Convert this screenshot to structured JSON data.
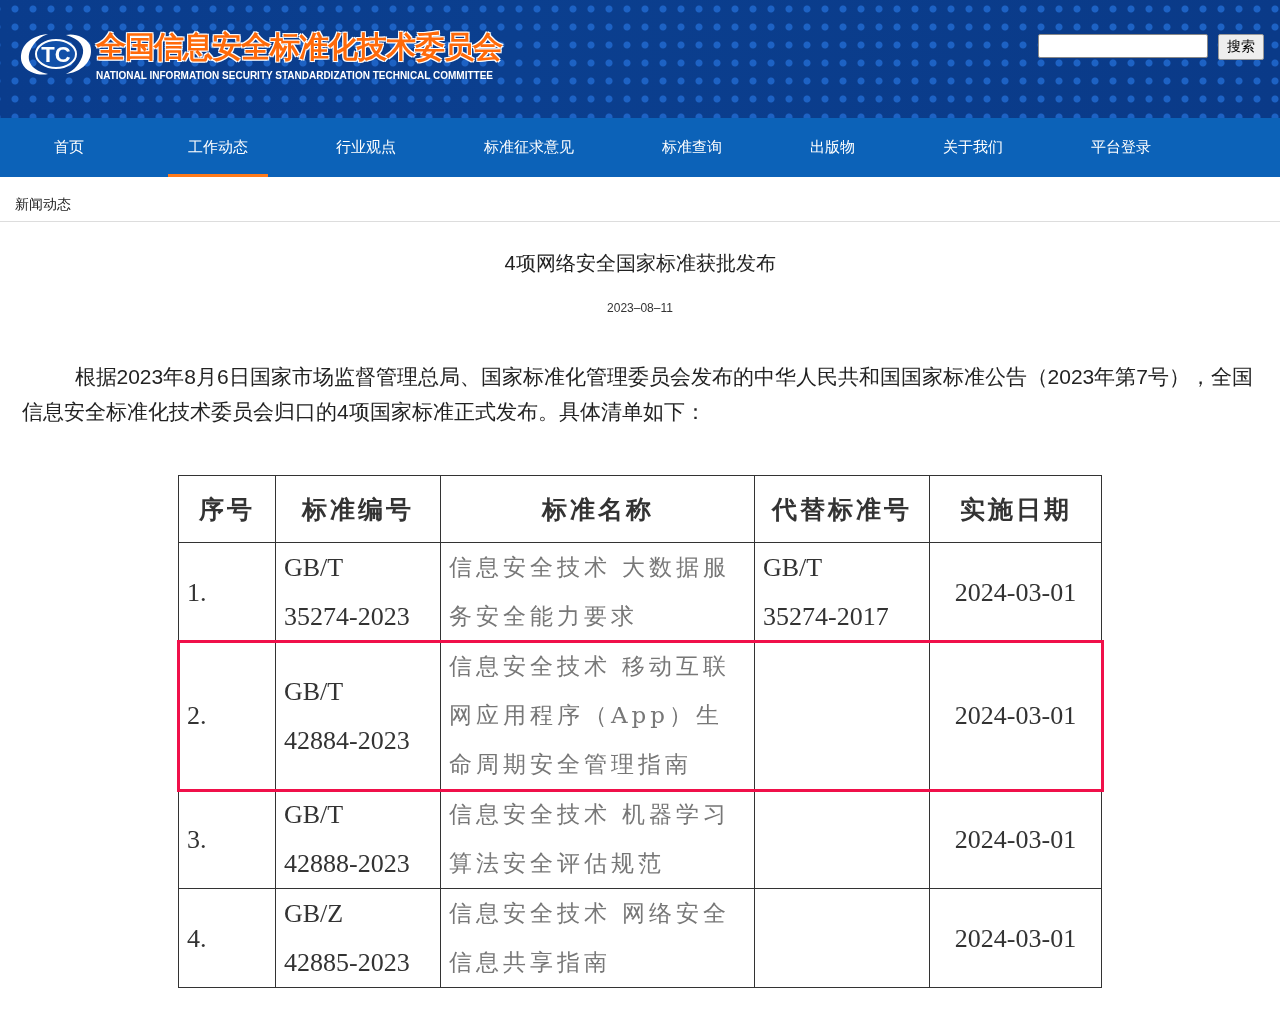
{
  "header": {
    "logo_mark": "TC",
    "title": "全国信息安全标准化技术委员会",
    "subtitle": "NATIONAL INFORMATION SECURITY STANDARDIZATION TECHNICAL COMMITTEE",
    "search": {
      "button": "搜索"
    }
  },
  "nav": [
    {
      "label": "首页",
      "selected": false
    },
    {
      "label": "工作动态",
      "selected": true
    },
    {
      "label": "行业观点",
      "selected": false
    },
    {
      "label": "标准征求意见",
      "selected": false
    },
    {
      "label": "标准查询",
      "selected": false
    },
    {
      "label": "出版物",
      "selected": false
    },
    {
      "label": "关于我们",
      "selected": false
    },
    {
      "label": "平台登录",
      "selected": false
    }
  ],
  "breadcrumb": "新闻动态",
  "article": {
    "title": "4项网络安全国家标准获批发布",
    "date": "2023–08–11",
    "body": "根据2023年8月6日国家市场监督管理总局、国家标准化管理委员会发布的中华人民共和国国家标准公告（2023年第7号），全国信息安全标准化技术委员会归口的4项国家标准正式发布。具体清单如下："
  },
  "table": {
    "columns": [
      "序号",
      "标准编号",
      "标准名称",
      "代替标准号",
      "实施日期"
    ],
    "rows": [
      {
        "cells": [
          "1.",
          "GB/T 35274-2023",
          "信息安全技术 大数据服务安全能力要求",
          "GB/T 35274-2017",
          "2024-03-01"
        ],
        "highlighted": false
      },
      {
        "cells": [
          "2.",
          "GB/T 42884-2023",
          "信息安全技术 移动互联网应用程序（App）生命周期安全管理指南",
          "",
          "2024-03-01"
        ],
        "highlighted": true
      },
      {
        "cells": [
          "3.",
          "GB/T 42888-2023",
          "信息安全技术 机器学习算法安全评估规范",
          "",
          "2024-03-01"
        ],
        "highlighted": false
      },
      {
        "cells": [
          "4.",
          "GB/Z 42885-2023",
          "信息安全技术 网络安全信息共享指南",
          "",
          "2024-03-01"
        ],
        "highlighted": false
      }
    ]
  }
}
